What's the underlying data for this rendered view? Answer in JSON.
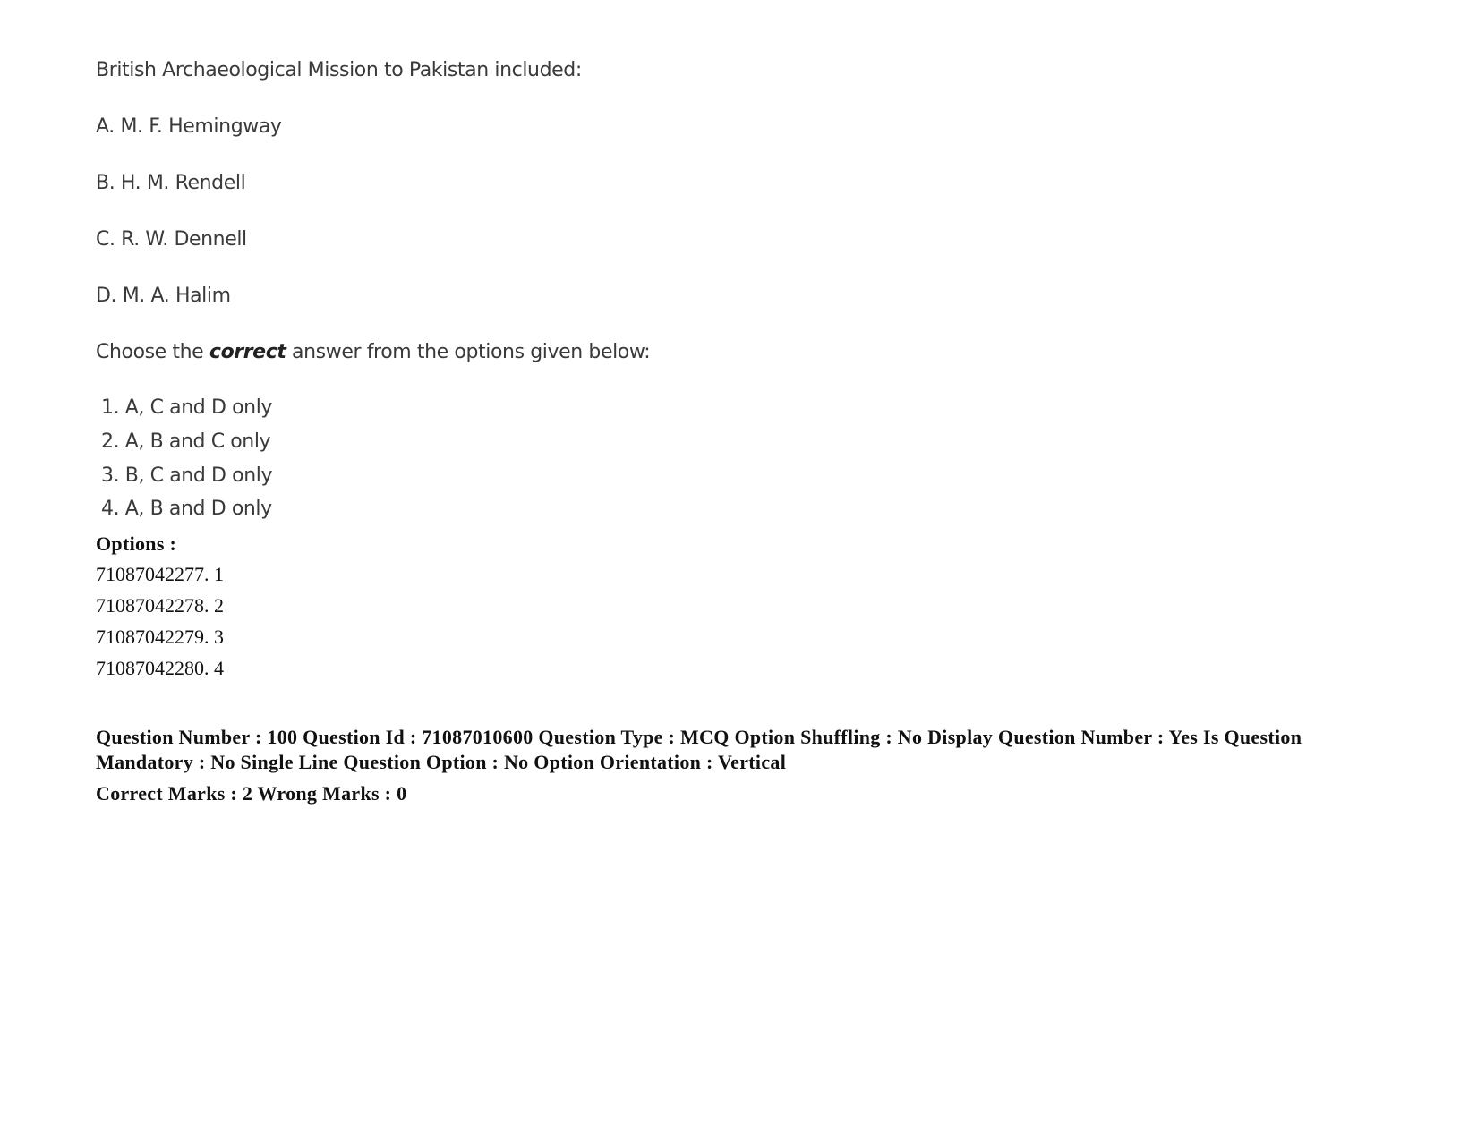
{
  "question": {
    "stem": "British Archaeological Mission to Pakistan included:",
    "statements": [
      "A. M. F. Hemingway",
      "B. H. M. Rendell",
      "C. R. W. Dennell",
      "D. M. A. Halim"
    ],
    "instruction_prefix": "Choose the ",
    "instruction_emphasis": "correct",
    "instruction_suffix": " answer from the options given below:",
    "choices": [
      "1. A, C and D only",
      "2. A, B and C only",
      "3. B, C and D only",
      "4. A, B and D only"
    ]
  },
  "options": {
    "heading": "Options :",
    "items": [
      "71087042277. 1",
      "71087042278. 2",
      "71087042279. 3",
      "71087042280. 4"
    ]
  },
  "next_question_meta": {
    "line1": "Question Number : 100 Question Id : 71087010600 Question Type : MCQ Option Shuffling : No Display Question Number : Yes Is Question Mandatory : No Single Line Question Option : No Option Orientation : Vertical",
    "marks": "Correct Marks : 2 Wrong Marks : 0"
  }
}
